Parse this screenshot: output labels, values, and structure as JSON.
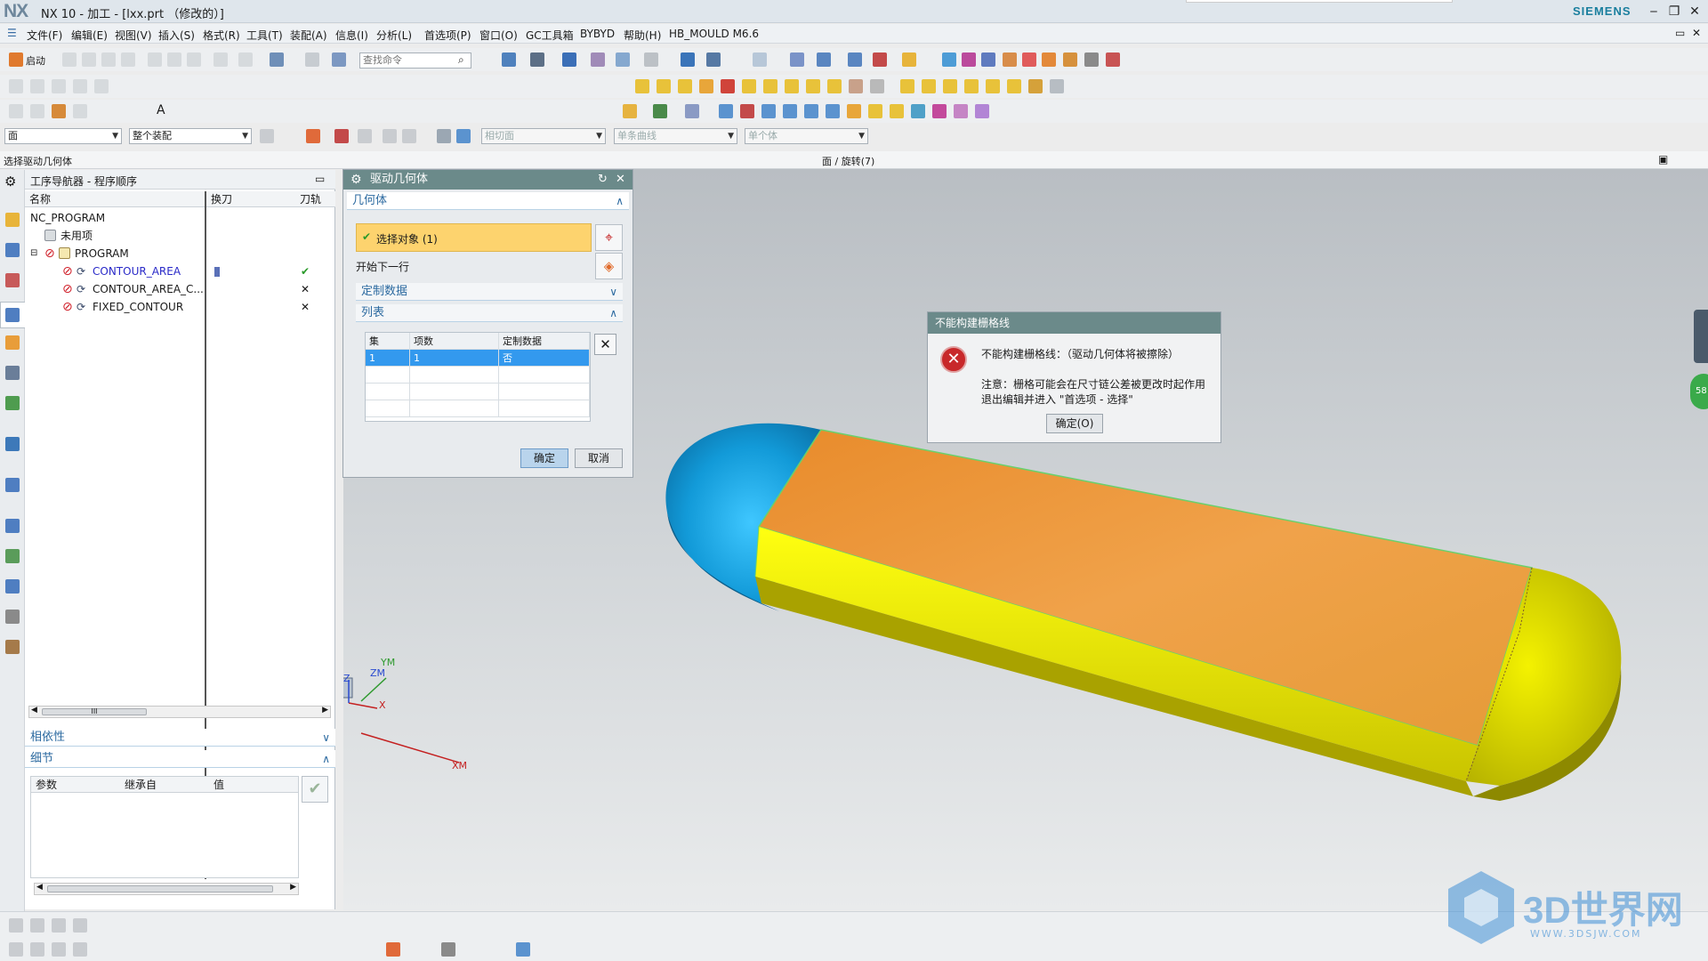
{
  "window": {
    "logo": "NX",
    "title": "NX 10 - 加工 - [lxx.prt （修改的）]",
    "brand": "SIEMENS",
    "minimize_icon": "minimize-icon",
    "restore_icon": "restore-icon",
    "close_icon": "close-icon"
  },
  "menubar": {
    "items": [
      "文件(F)",
      "编辑(E)",
      "视图(V)",
      "插入(S)",
      "格式(R)",
      "工具(T)",
      "装配(A)",
      "信息(I)",
      "分析(L)",
      "首选项(P)",
      "窗口(O)",
      "GC工具箱",
      "BYBYD",
      "帮助(H)",
      "HB_MOULD M6.6"
    ]
  },
  "toolbar": {
    "start_label": "启动",
    "command_search_placeholder": "查找命令"
  },
  "selection_bar": {
    "filter_type": "面",
    "scope": "整个装配",
    "tangent": "相切面",
    "curve_rule": "单条曲线",
    "single": "单个体"
  },
  "cue_line": {
    "prompt": "选择驱动几何体",
    "status": "面 / 旋转(7)"
  },
  "navigator": {
    "title": "工序导航器 - 程序顺序",
    "columns": [
      "名称",
      "换刀",
      "刀轨"
    ],
    "rows": [
      {
        "name": "NC_PROGRAM",
        "indent": 0,
        "toolpath": ""
      },
      {
        "name": "未用项",
        "indent": 1,
        "toolpath": ""
      },
      {
        "name": "PROGRAM",
        "indent": 1,
        "toolpath": ""
      },
      {
        "name": "CONTOUR_AREA",
        "indent": 3,
        "toolpath": "✔"
      },
      {
        "name": "CONTOUR_AREA_C...",
        "indent": 3,
        "toolpath": "✕"
      },
      {
        "name": "FIXED_CONTOUR",
        "indent": 3,
        "toolpath": "✕"
      }
    ],
    "scroll_glyph": "III",
    "dependency_label": "相依性",
    "details_label": "细节",
    "details_columns": [
      "参数",
      "继承自",
      "值"
    ]
  },
  "dialog": {
    "title": "驱动几何体",
    "geometry_section": "几何体",
    "select_object": "选择对象 (1)",
    "start_next_row": "开始下一行",
    "custom_data": "定制数据",
    "list_section": "列表",
    "table_columns": [
      "集",
      "项数",
      "定制数据"
    ],
    "table_rows": [
      [
        "1",
        "1",
        "否"
      ]
    ],
    "ok": "确定",
    "cancel": "取消"
  },
  "error_dialog": {
    "title": "不能构建栅格线",
    "message": "不能构建栅格线：（驱动几何体将被擦除）",
    "note_line1": "注意：栅格可能会在尺寸链公差被更改时起作用",
    "note_line2": "退出编辑并进入 \"首选项 - 选择\"",
    "ok": "确定(O)"
  },
  "triad": {
    "ym": "YM",
    "zm": "ZM",
    "z": "Z",
    "x": "X",
    "xm": "XM"
  },
  "side_badge": "58",
  "watermark": {
    "text": "3D世界网",
    "url": "WWW.3DSJW.COM"
  },
  "colors": {
    "accent_dialog": "#6b8a8a",
    "select_highlight": "#fdd36e",
    "body_cyan": "#1b9ed6",
    "body_orange": "#e5962f",
    "body_yellow": "#f2f200"
  }
}
